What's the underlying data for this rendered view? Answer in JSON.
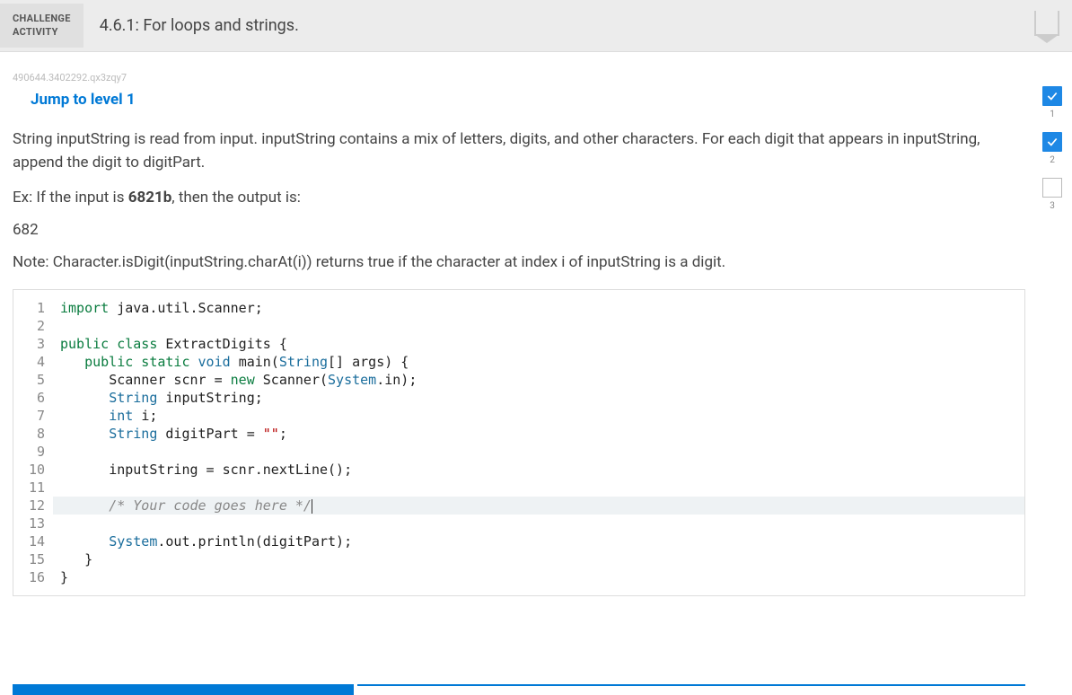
{
  "header": {
    "challenge_label_line1": "CHALLENGE",
    "challenge_label_line2": "ACTIVITY",
    "title": "4.6.1: For loops and strings."
  },
  "hash": "490644.3402292.qx3zqy7",
  "jump_link": "Jump to level 1",
  "instructions": {
    "main": "String inputString is read from input. inputString contains a mix of letters, digits, and other characters. For each digit that appears in inputString, append the digit to digitPart.",
    "example_prefix": "Ex: If the input is ",
    "example_input": "6821b",
    "example_suffix": ", then the output is:",
    "example_output": "682",
    "note": "Note: Character.isDigit(inputString.charAt(i)) returns true if the character at index i of inputString is a digit."
  },
  "code": {
    "lines": [
      {
        "n": "1",
        "html": "<span class='kw'>import</span> <span class='plain'>java.util.Scanner;</span>"
      },
      {
        "n": "2",
        "html": ""
      },
      {
        "n": "3",
        "html": "<span class='kw'>public class</span> <span class='plain'>ExtractDigits {</span>"
      },
      {
        "n": "4",
        "html": "   <span class='kw'>public static</span> <span class='type'>void</span> <span class='plain'>main(</span><span class='type'>String</span><span class='plain'>[] args) {</span>"
      },
      {
        "n": "5",
        "html": "      <span class='plain'>Scanner scnr = </span><span class='kw'>new</span> <span class='plain'>Scanner(</span><span class='type'>System</span><span class='plain'>.in);</span>"
      },
      {
        "n": "6",
        "html": "      <span class='type'>String</span> <span class='plain'>inputString;</span>"
      },
      {
        "n": "7",
        "html": "      <span class='type'>int</span> <span class='plain'>i;</span>"
      },
      {
        "n": "8",
        "html": "      <span class='type'>String</span> <span class='plain'>digitPart = </span><span class='str'>\"\"</span><span class='plain'>;</span>"
      },
      {
        "n": "9",
        "html": ""
      },
      {
        "n": "10",
        "html": "      <span class='plain'>inputString = scnr.nextLine();</span>"
      },
      {
        "n": "11",
        "html": ""
      },
      {
        "n": "12",
        "html": "      <span class='cm'>/* Your code goes here */</span>",
        "highlight": true,
        "cursor": true
      },
      {
        "n": "13",
        "html": ""
      },
      {
        "n": "14",
        "html": "      <span class='type'>System</span><span class='plain'>.out.println(digitPart);</span>"
      },
      {
        "n": "15",
        "html": "   <span class='plain'>}</span>"
      },
      {
        "n": "16",
        "html": "<span class='plain'>}</span>"
      }
    ]
  },
  "levels": [
    {
      "num": "1",
      "done": true
    },
    {
      "num": "2",
      "done": true
    },
    {
      "num": "3",
      "done": false
    }
  ]
}
